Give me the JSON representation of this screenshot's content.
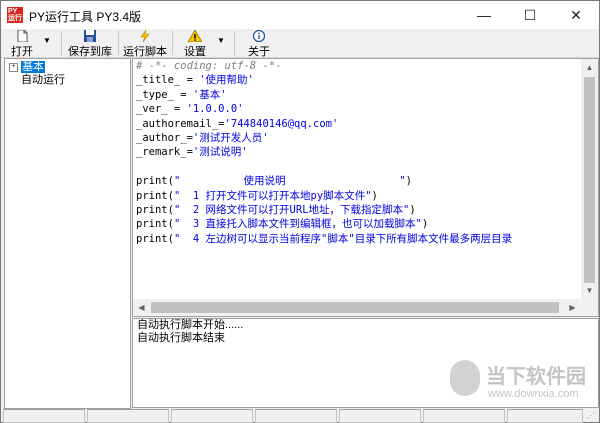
{
  "window": {
    "title": "PY运行工具 PY3.4版",
    "icon_text": [
      "PY",
      "运行"
    ],
    "controls": {
      "minimize": "—",
      "maximize": "☐",
      "close": "✕"
    }
  },
  "toolbar": {
    "buttons": [
      {
        "label": "打开",
        "icon": "open-file-icon",
        "has_dropdown": true
      },
      {
        "label": "保存到库",
        "icon": "save-disk-icon"
      },
      {
        "label": "运行脚本",
        "icon": "lightning-icon"
      },
      {
        "label": "设置",
        "icon": "warning-icon",
        "has_dropdown": true
      },
      {
        "label": "关于",
        "icon": "info-icon"
      }
    ],
    "dropdown_arrow": "▼"
  },
  "tree": {
    "items": [
      {
        "label": "基本",
        "expander": "+",
        "selected": true
      },
      {
        "label": "自动运行"
      }
    ]
  },
  "editor": {
    "lines": [
      {
        "a": "# -*- coding: utf-8 -*-",
        "b": "",
        "c": ""
      },
      {
        "a": "_title_ = ",
        "b": "'使用帮助'",
        "c": ""
      },
      {
        "a": "_type_ = ",
        "b": "'基本'",
        "c": ""
      },
      {
        "a": "_ver_ = ",
        "b": "'1.0.0.0'",
        "c": ""
      },
      {
        "a": "_authoremail_=",
        "b": "'744840146@qq.com'",
        "c": ""
      },
      {
        "a": "_author_=",
        "b": "'测试开发人员'",
        "c": ""
      },
      {
        "a": "_remark_=",
        "b": "'测试说明'",
        "c": ""
      },
      {
        "a": "",
        "b": "",
        "c": ""
      },
      {
        "a": "print(",
        "b": "\"          使用说明                  \"",
        "c": ")"
      },
      {
        "a": "print(",
        "b": "\"  1 打开文件可以打开本地py脚本文件\"",
        "c": ")"
      },
      {
        "a": "print(",
        "b": "\"  2 网络文件可以打开URL地址，下载指定脚本\"",
        "c": ")"
      },
      {
        "a": "print(",
        "b": "\"  3 直接托入脚本文件到编辑框，也可以加载脚本\"",
        "c": ")"
      },
      {
        "a": "print(",
        "b": "\"  4 左边树可以显示当前程序\"脚本\"目录下所有脚本文件最多两层目录",
        "c": ""
      }
    ]
  },
  "log": {
    "lines": [
      "自动执行脚本开始......",
      "自动执行脚本结束"
    ]
  },
  "watermark": {
    "title": "当下软件园",
    "url": "www.downxia.com"
  },
  "colors": {
    "selection": "#0078d7",
    "string": "#0000e0",
    "comment": "#7f7f7f",
    "icon_red": "#d9261c"
  }
}
